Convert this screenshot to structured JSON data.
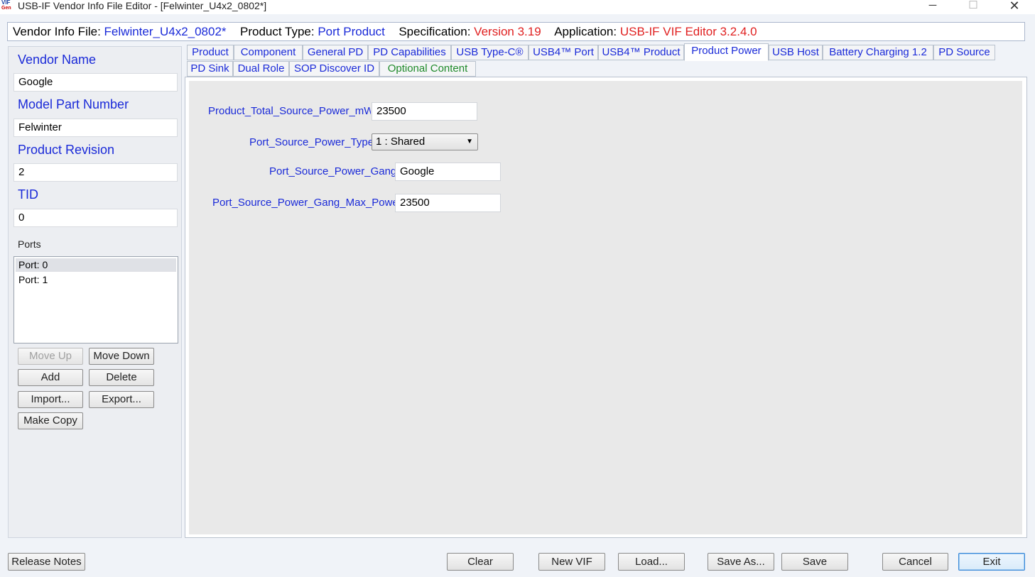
{
  "window": {
    "title": "USB-IF Vendor Info File Editor - [Felwinter_U4x2_0802*]",
    "icon_text_top": "VIF",
    "icon_text_bottom": "Gen",
    "min_glyph": "─",
    "max_glyph": "☐",
    "close_glyph": "✕"
  },
  "infobar": {
    "vif_label": "Vendor Info File:",
    "vif_value": "Felwinter_U4x2_0802*",
    "product_type_label": "Product Type:",
    "product_type_value": "Port Product",
    "spec_label": "Specification:",
    "spec_value": "Version 3.19",
    "app_label": "Application:",
    "app_value": "USB-IF VIF Editor 3.2.4.0"
  },
  "left": {
    "vendor_name_label": "Vendor Name",
    "vendor_name_value": "Google",
    "model_part_label": "Model Part Number",
    "model_part_value": "Felwinter",
    "product_revision_label": "Product Revision",
    "product_revision_value": "2",
    "tid_label": "TID",
    "tid_value": "0",
    "ports_label": "Ports",
    "ports": [
      "Port: 0",
      "Port: 1"
    ],
    "buttons": {
      "move_up": "Move Up",
      "move_down": "Move Down",
      "add": "Add",
      "delete": "Delete",
      "import": "Import...",
      "export": "Export...",
      "make_copy": "Make Copy"
    }
  },
  "tabs": [
    "Product",
    "Component",
    "General PD",
    "PD Capabilities",
    "USB Type-C®",
    "USB4™ Port",
    "USB4™ Product",
    "Product Power",
    "USB Host",
    "Battery Charging 1.2",
    "PD Source",
    "PD Sink",
    "Dual Role",
    "SOP Discover ID",
    "Optional Content"
  ],
  "active_tab": "Product Power",
  "product_power": {
    "total_source_power_label": "Product_Total_Source_Power_mW",
    "total_source_power_value": "23500",
    "port_source_power_type_label": "Port_Source_Power_Type",
    "port_source_power_type_value": "1 : Shared",
    "port_source_power_gang_label": "Port_Source_Power_Gang",
    "port_source_power_gang_value": "Google",
    "port_source_power_gang_max_label": "Port_Source_Power_Gang_Max_Power",
    "port_source_power_gang_max_value": "23500"
  },
  "bottom": {
    "release_notes": "Release Notes",
    "clear": "Clear",
    "new_vif": "New VIF",
    "load": "Load...",
    "save_as": "Save As...",
    "save": "Save",
    "cancel": "Cancel",
    "exit": "Exit"
  }
}
